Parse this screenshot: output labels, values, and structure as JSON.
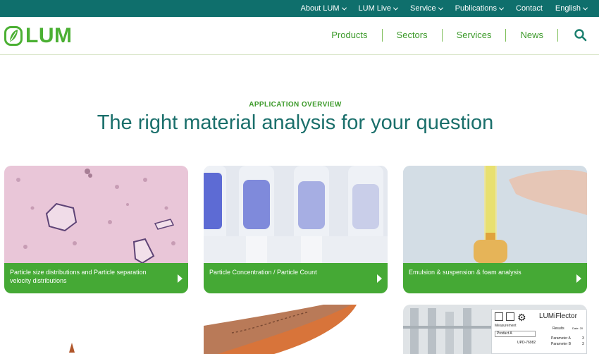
{
  "topbar": {
    "items": [
      {
        "label": "About LUM",
        "has_menu": true
      },
      {
        "label": "LUM Live",
        "has_menu": true
      },
      {
        "label": "Service",
        "has_menu": true
      },
      {
        "label": "Publications",
        "has_menu": true
      },
      {
        "label": "Contact",
        "has_menu": false
      },
      {
        "label": "English",
        "has_menu": true
      }
    ]
  },
  "header": {
    "logo_text": "LUM",
    "nav": [
      "Products",
      "Sectors",
      "Services",
      "News"
    ]
  },
  "hero": {
    "eyebrow": "APPLICATION OVERVIEW",
    "headline": "The right material analysis for your question"
  },
  "cards": [
    {
      "label": "Particle size distributions and Particle separation velocity distributions"
    },
    {
      "label": "Particle Concentration / Particle Count"
    },
    {
      "label": "Emulsion & suspension & foam analysis"
    }
  ],
  "partial_card_3": {
    "title": "LUMiFlector",
    "measurement": "Measurement",
    "results": "Results",
    "date": "Date: 20",
    "product": "Product A",
    "code": "UPD-76982",
    "param_a": "Parameter A",
    "param_b": "Parameter B",
    "param_a_value": "3",
    "param_b_value": "3"
  },
  "colors": {
    "topbar": "#0f6f6c",
    "brand_green": "#4bb033",
    "card_bar": "#45a935",
    "headline": "#1a6f6b"
  }
}
